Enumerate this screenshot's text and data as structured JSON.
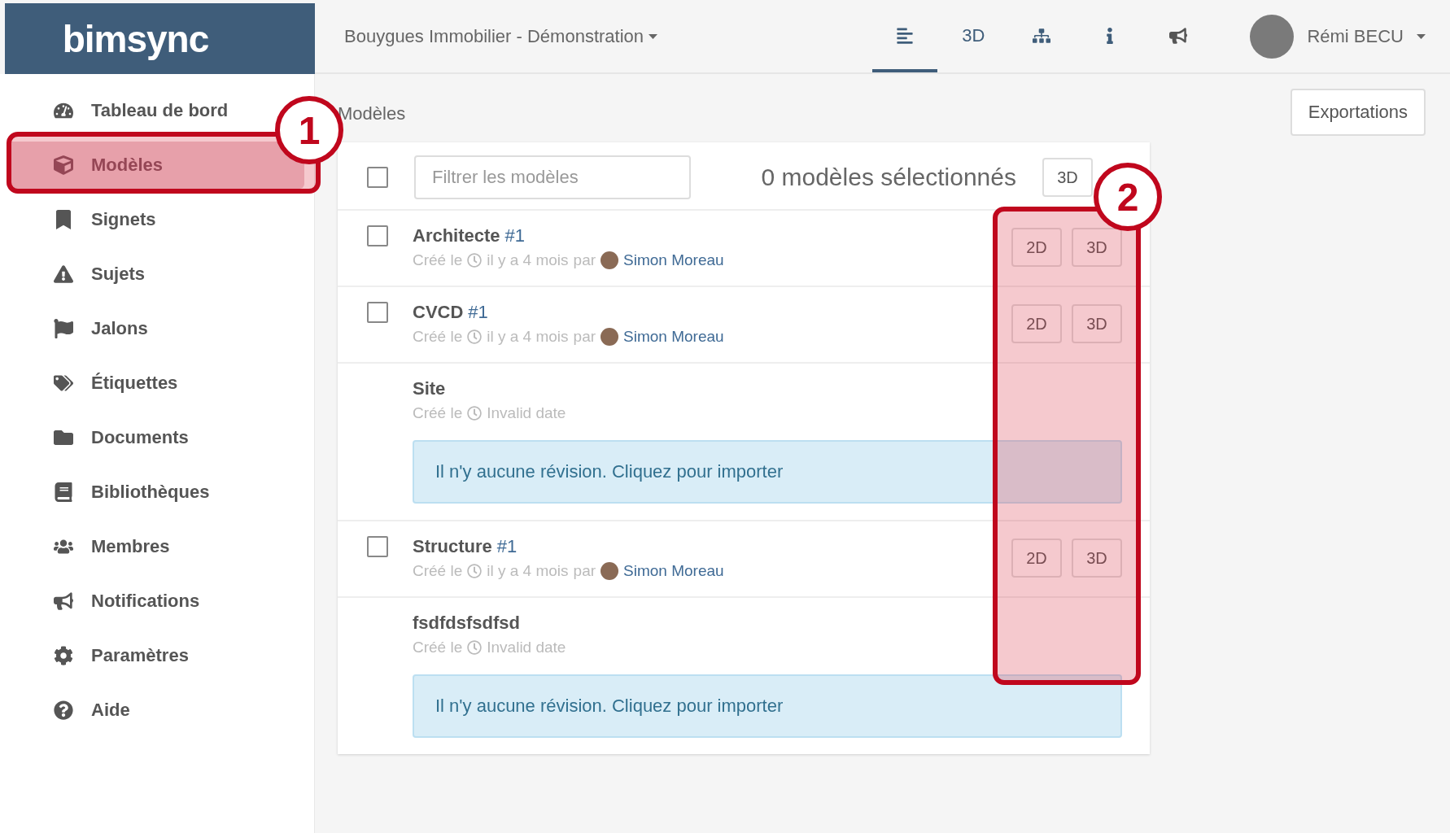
{
  "logo": "bimsync",
  "project": {
    "label": "Bouygues Immobilier - Démonstration"
  },
  "nav_tabs": [
    {
      "kind": "list",
      "selected": true
    },
    {
      "kind": "text",
      "label": "3D",
      "selected": false
    },
    {
      "kind": "tree",
      "selected": false
    },
    {
      "kind": "info",
      "selected": false
    },
    {
      "kind": "announce",
      "selected": false
    }
  ],
  "user": {
    "name": "Rémi BECU"
  },
  "sidebar": {
    "items": [
      {
        "label": "Tableau de bord",
        "selected": false
      },
      {
        "label": "Modèles",
        "selected": true
      },
      {
        "label": "Signets",
        "selected": false
      },
      {
        "label": "Sujets",
        "selected": false
      },
      {
        "label": "Jalons",
        "selected": false
      },
      {
        "label": "Étiquettes",
        "selected": false
      },
      {
        "label": "Documents",
        "selected": false
      },
      {
        "label": "Bibliothèques",
        "selected": false
      },
      {
        "label": "Membres",
        "selected": false
      },
      {
        "label": "Notifications",
        "selected": false
      },
      {
        "label": "Paramètres",
        "selected": false
      },
      {
        "label": "Aide",
        "selected": false
      }
    ]
  },
  "breadcrumb": "Modèles",
  "export_button": "Exportations",
  "toolbar": {
    "checked": false,
    "filter_placeholder": "Filtrer les modèles",
    "selection_count": "0 modèles sélectionnés",
    "button": "3D"
  },
  "models": [
    {
      "kind": "revision",
      "name": "Architecte",
      "revision": "#1",
      "checked": false,
      "created": "Créé le",
      "time": "il y a 4 mois",
      "by": "par",
      "author": "Simon Moreau",
      "buttons": [
        "2D",
        "3D"
      ]
    },
    {
      "kind": "revision",
      "name": "CVCD",
      "revision": "#1",
      "checked": false,
      "created": "Créé le",
      "time": "il y a 4 mois",
      "by": "par",
      "author": "Simon Moreau",
      "buttons": [
        "2D",
        "3D"
      ]
    },
    {
      "kind": "empty",
      "name": "Site",
      "created": "Créé le",
      "time": "Invalid date",
      "notice": "Il n'y aucune révision. Cliquez pour importer"
    },
    {
      "kind": "revision",
      "name": "Structure",
      "revision": "#1",
      "checked": false,
      "created": "Créé le",
      "time": "il y a 4 mois",
      "by": "par",
      "author": "Simon Moreau",
      "buttons": [
        "2D",
        "3D"
      ]
    },
    {
      "kind": "empty",
      "name": "fsdfdsfsdfsd",
      "created": "Créé le",
      "time": "Invalid date",
      "notice": "Il n'y aucune révision. Cliquez pour importer"
    }
  ],
  "callouts": [
    {
      "label": "1"
    },
    {
      "label": "2"
    }
  ]
}
